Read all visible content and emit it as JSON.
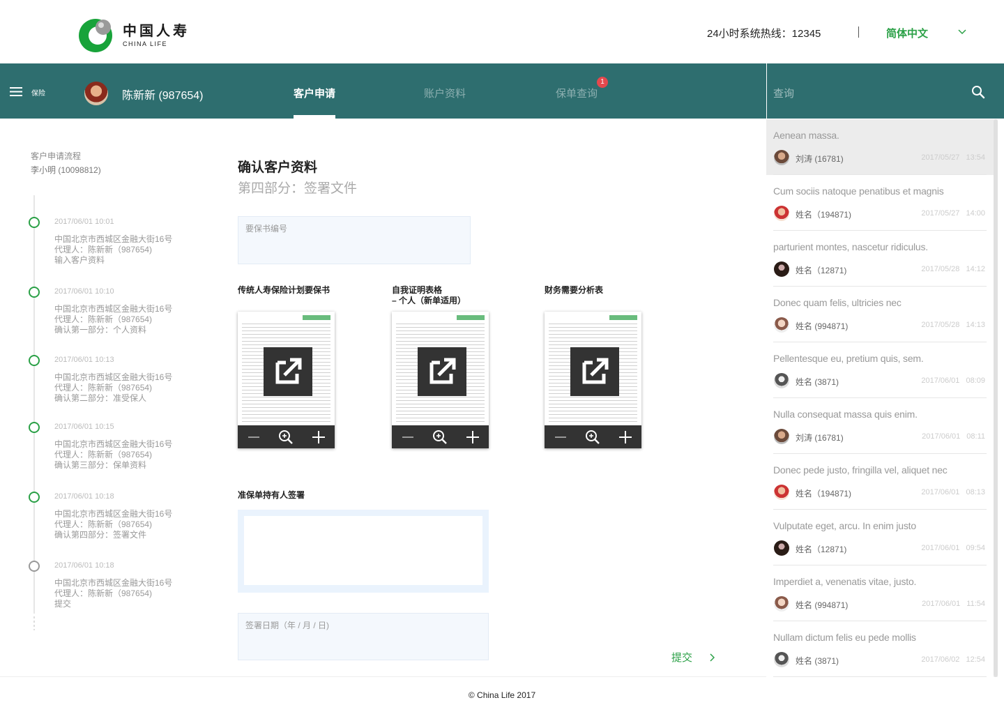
{
  "brand": {
    "cn": "中国人寿",
    "en": "CHINA LIFE",
    "green": "#2aa046",
    "teal": "#2e6e6f"
  },
  "header": {
    "hotline": "24小时系统热线：12345",
    "language": "简体中文"
  },
  "nav": {
    "menu_label": "保险",
    "user": "陈新新 (987654)",
    "tabs": [
      {
        "label": "客户申请",
        "active": true
      },
      {
        "label": "账户资料",
        "active": false
      },
      {
        "label": "保单查询",
        "active": false,
        "badge": "1"
      }
    ],
    "search_placeholder": "查询"
  },
  "timeline": {
    "title": "客户申请流程",
    "subtitle": "李小明 (10098812)",
    "items": [
      {
        "time": "2017/06/01   10:01",
        "lines": [
          "中国北京市西城区金融大街16号",
          "代理人：陈新新（987654)",
          "输入客户资料"
        ],
        "status": "done"
      },
      {
        "time": "2017/06/01   10:10",
        "lines": [
          "中国北京市西城区金融大街16号",
          "代理人：陈新新（987654)",
          "确认第一部分：个人资料"
        ],
        "status": "done"
      },
      {
        "time": "2017/06/01   10:13",
        "lines": [
          "中国北京市西城区金融大街16号",
          "代理人：陈新新（987654)",
          "确认第二部分：准受保人"
        ],
        "status": "done"
      },
      {
        "time": "2017/06/01   10:15",
        "lines": [
          "中国北京市西城区金融大街16号",
          "代理人：陈新新（987654)",
          "确认第三部分：保单资料"
        ],
        "status": "done"
      },
      {
        "time": "2017/06/01   10:18",
        "lines": [
          "中国北京市西城区金融大街16号",
          "代理人：陈新新（987654)",
          "确认第四部分：签署文件"
        ],
        "status": "done"
      },
      {
        "time": "2017/06/01   10:18",
        "lines": [
          "中国北京市西城区金融大街16号",
          "代理人：陈新新（987654)",
          "提交"
        ],
        "status": "pending"
      }
    ]
  },
  "main": {
    "title": "确认客户资料",
    "subtitle": "第四部分：签署文件",
    "proposal_placeholder": "要保书编号",
    "documents": [
      {
        "label": "传统人寿保险计划要保书"
      },
      {
        "label": "自我证明表格\n– 个人（新单适用）"
      },
      {
        "label": "财务需要分析表"
      }
    ],
    "signature_label": "准保单持有人签署",
    "date_placeholder": "签署日期（年 / 月 / 日)",
    "submit_label": "提交"
  },
  "list": {
    "items": [
      {
        "title": "Aenean massa.",
        "name": "刘涛 (16781)",
        "date": "2017/05/27 13:54",
        "selected": true
      },
      {
        "title": "Cum sociis natoque penatibus et magnis",
        "name": "姓名（194871)",
        "date": "2017/05/27 14:00"
      },
      {
        "title": "parturient montes, nascetur ridiculus.",
        "name": "姓名（12871)",
        "date": "2017/05/28 14:12"
      },
      {
        "title": "Donec quam felis, ultricies nec",
        "name": "姓名 (994871)",
        "date": "2017/05/28 14:13"
      },
      {
        "title": "Pellentesque eu, pretium quis, sem.",
        "name": "姓名 (3871)",
        "date": "2017/06/01 08:09"
      },
      {
        "title": "Nulla consequat massa quis enim.",
        "name": "刘涛 (16781)",
        "date": "2017/06/01 08:11"
      },
      {
        "title": "Donec pede justo, fringilla vel, aliquet nec",
        "name": "姓名（194871)",
        "date": "2017/06/01 08:13"
      },
      {
        "title": "Vulputate eget, arcu. In enim justo",
        "name": "姓名（12871)",
        "date": "2017/06/01 09:54"
      },
      {
        "title": "Imperdiet a, venenatis vitae, justo.",
        "name": "姓名 (994871)",
        "date": "2017/06/01 11:54"
      },
      {
        "title": "Nullam dictum felis eu pede mollis",
        "name": "姓名 (3871)",
        "date": "2017/06/02 12:54"
      }
    ]
  },
  "footer": {
    "copyright": "© China Life 2017"
  }
}
